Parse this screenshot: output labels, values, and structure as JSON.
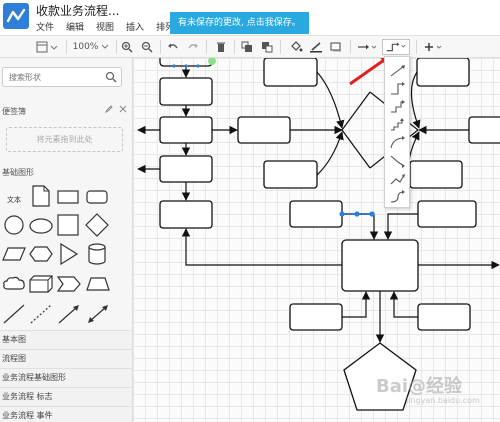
{
  "app": {
    "title": "收款业务流程...",
    "menu": [
      "文件",
      "编辑",
      "视图",
      "插入",
      "排列"
    ],
    "unsaved_notice": "有未保存的更改, 点击我保存。"
  },
  "toolbar": {
    "zoom": "100%"
  },
  "sidebar": {
    "search_placeholder": "搜索形状",
    "notes_title": "便签簿",
    "dropzone_text": "将元素拖到此处",
    "basic_title": "基础图形",
    "text_shape_label": "文本",
    "categories": [
      "基本图",
      "流程图",
      "业务流程基础图形",
      "业务流程 标志",
      "业务流程 事件"
    ]
  },
  "watermark": {
    "main": "Bai@经验",
    "sub": "jingyan.baidu.com"
  },
  "colors": {
    "accent": "#29a9e0",
    "logo": "#2f7fd8",
    "arrow_red": "#e02020",
    "handle_blue": "#2b7fe0"
  },
  "icons": [
    "logo-icon",
    "page-icon",
    "zoom-in-icon",
    "zoom-out-icon",
    "undo-icon",
    "redo-icon",
    "delete-icon",
    "bring-front-icon",
    "send-back-icon",
    "fill-icon",
    "line-color-icon",
    "shadow-icon",
    "arrow-style-icon",
    "connector-style-icon",
    "add-icon",
    "search-icon",
    "edit-icon",
    "close-icon"
  ]
}
